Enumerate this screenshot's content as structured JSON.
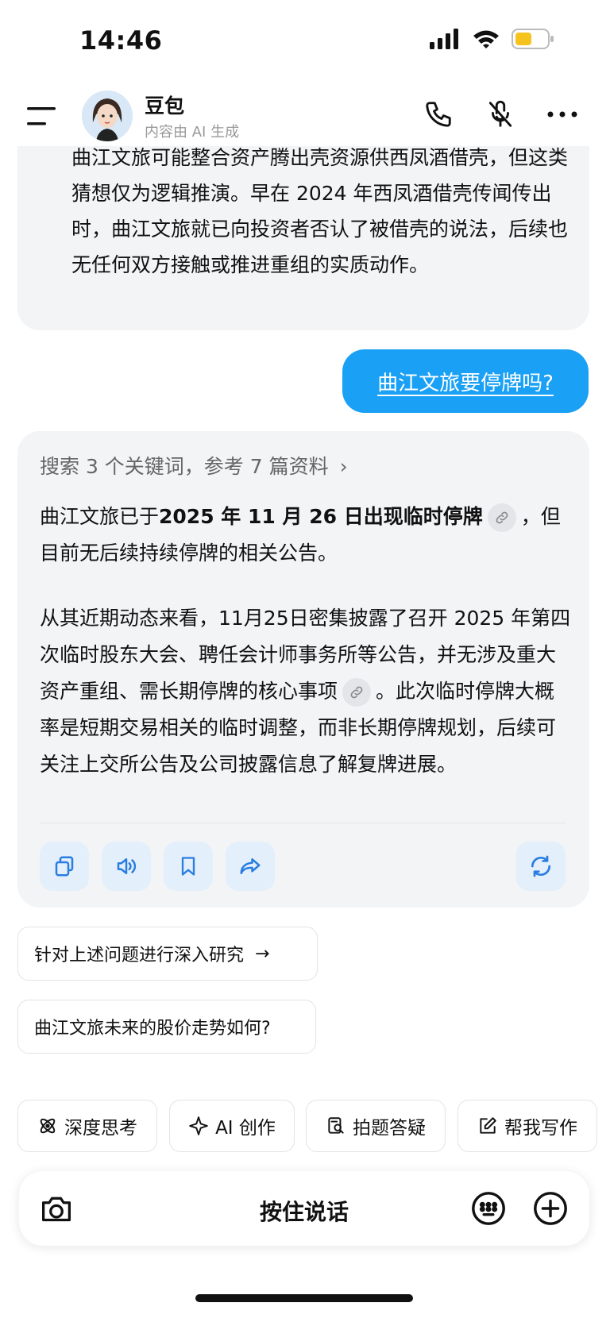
{
  "status_bar": {
    "time": "14:46",
    "battery_color": "#f6c21c"
  },
  "header": {
    "title": "豆包",
    "subtitle": "内容由 AI 生成",
    "icons": [
      "menu-icon",
      "avatar",
      "phone-icon",
      "mute-icon",
      "more-icon"
    ]
  },
  "previous_message": {
    "text": "曲江文旅可能整合资产腾出壳资源供西凤酒借壳，但这类猜想仅为逻辑推演。早在 2024 年西凤酒借壳传闻传出时，曲江文旅就已向投资者否认了被借壳的说法，后续也无任何双方接触或推进重组的实质动作。"
  },
  "user_message": {
    "text": "曲江文旅要停牌吗?"
  },
  "answer": {
    "search_summary": "搜索 3 个关键词，参考 7 篇资料",
    "p1_before": "曲江文旅已于",
    "p1_bold": "2025 年 11 月 26 日出现临时停牌",
    "p1_after": "，但目前无后续持续停牌的相关公告。",
    "p2_before": "从其近期动态来看，11月25日密集披露了召开 2025 年第四次临时股东大会、聘任会计师事务所等公告，并无涉及重大资产重组、需长期停牌的核心事项",
    "p2_after": "。此次临时停牌大概率是短期交易相关的临时调整，而非长期停牌规划，后续可关注上交所公告及公司披露信息了解复牌进展。",
    "actions": [
      "copy-icon",
      "speaker-icon",
      "bookmark-icon",
      "share-icon",
      "regenerate-icon"
    ]
  },
  "suggestions": [
    {
      "text": "针对上述问题进行深入研究"
    },
    {
      "text": "曲江文旅未来的股价走势如何?"
    }
  ],
  "chips": [
    {
      "label": "深度思考",
      "icon": "atom-icon"
    },
    {
      "label": "AI 创作",
      "icon": "sparkle-icon"
    },
    {
      "label": "拍题答疑",
      "icon": "scan-icon"
    },
    {
      "label": "帮我写作",
      "icon": "edit-icon"
    }
  ],
  "input_bar": {
    "label": "按住说话"
  },
  "colors": {
    "accent": "#1aa0f5",
    "card_bg": "#f3f4f6",
    "action_bg": "#e3effb",
    "action_icon": "#2a7de1"
  }
}
